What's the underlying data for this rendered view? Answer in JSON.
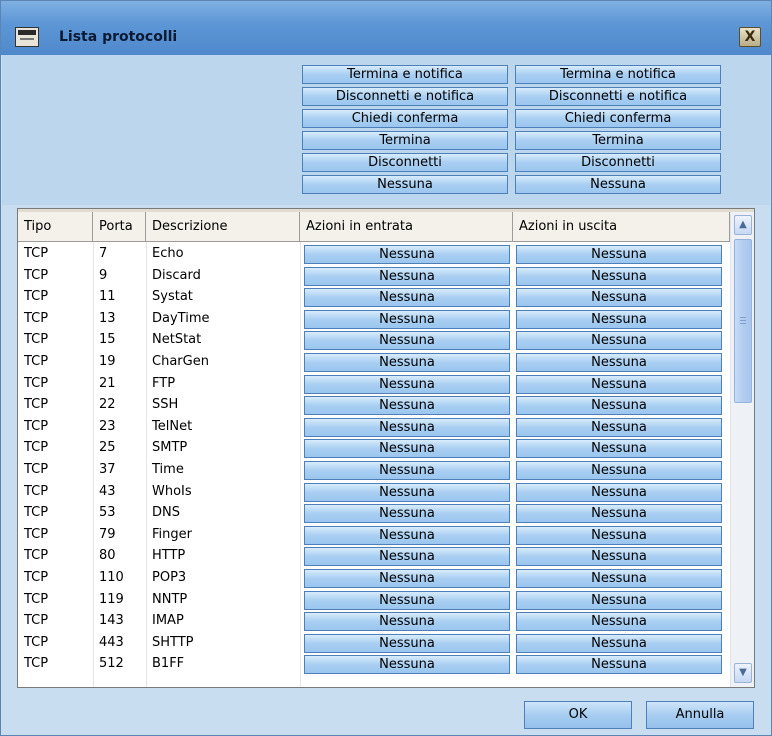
{
  "window": {
    "title": "Lista protocolli",
    "close_label": "X"
  },
  "actions": {
    "inbound": [
      "Termina e notifica",
      "Disconnetti e notifica",
      "Chiedi conferma",
      "Termina",
      "Disconnetti",
      "Nessuna"
    ],
    "outbound": [
      "Termina e notifica",
      "Disconnetti e notifica",
      "Chiedi conferma",
      "Termina",
      "Disconnetti",
      "Nessuna"
    ]
  },
  "table": {
    "columns": [
      "Tipo",
      "Porta",
      "Descrizione",
      "Azioni in entrata",
      "Azioni in uscita"
    ],
    "rows": [
      {
        "tipo": "TCP",
        "porta": "7",
        "descrizione": "Echo",
        "entrata": "Nessuna",
        "uscita": "Nessuna"
      },
      {
        "tipo": "TCP",
        "porta": "9",
        "descrizione": "Discard",
        "entrata": "Nessuna",
        "uscita": "Nessuna"
      },
      {
        "tipo": "TCP",
        "porta": "11",
        "descrizione": "Systat",
        "entrata": "Nessuna",
        "uscita": "Nessuna"
      },
      {
        "tipo": "TCP",
        "porta": "13",
        "descrizione": "DayTime",
        "entrata": "Nessuna",
        "uscita": "Nessuna"
      },
      {
        "tipo": "TCP",
        "porta": "15",
        "descrizione": "NetStat",
        "entrata": "Nessuna",
        "uscita": "Nessuna"
      },
      {
        "tipo": "TCP",
        "porta": "19",
        "descrizione": "CharGen",
        "entrata": "Nessuna",
        "uscita": "Nessuna"
      },
      {
        "tipo": "TCP",
        "porta": "21",
        "descrizione": "FTP",
        "entrata": "Nessuna",
        "uscita": "Nessuna"
      },
      {
        "tipo": "TCP",
        "porta": "22",
        "descrizione": "SSH",
        "entrata": "Nessuna",
        "uscita": "Nessuna"
      },
      {
        "tipo": "TCP",
        "porta": "23",
        "descrizione": "TelNet",
        "entrata": "Nessuna",
        "uscita": "Nessuna"
      },
      {
        "tipo": "TCP",
        "porta": "25",
        "descrizione": "SMTP",
        "entrata": "Nessuna",
        "uscita": "Nessuna"
      },
      {
        "tipo": "TCP",
        "porta": "37",
        "descrizione": "Time",
        "entrata": "Nessuna",
        "uscita": "Nessuna"
      },
      {
        "tipo": "TCP",
        "porta": "43",
        "descrizione": "WhoIs",
        "entrata": "Nessuna",
        "uscita": "Nessuna"
      },
      {
        "tipo": "TCP",
        "porta": "53",
        "descrizione": "DNS",
        "entrata": "Nessuna",
        "uscita": "Nessuna"
      },
      {
        "tipo": "TCP",
        "porta": "79",
        "descrizione": "Finger",
        "entrata": "Nessuna",
        "uscita": "Nessuna"
      },
      {
        "tipo": "TCP",
        "porta": "80",
        "descrizione": "HTTP",
        "entrata": "Nessuna",
        "uscita": "Nessuna"
      },
      {
        "tipo": "TCP",
        "porta": "110",
        "descrizione": "POP3",
        "entrata": "Nessuna",
        "uscita": "Nessuna"
      },
      {
        "tipo": "TCP",
        "porta": "119",
        "descrizione": "NNTP",
        "entrata": "Nessuna",
        "uscita": "Nessuna"
      },
      {
        "tipo": "TCP",
        "porta": "143",
        "descrizione": "IMAP",
        "entrata": "Nessuna",
        "uscita": "Nessuna"
      },
      {
        "tipo": "TCP",
        "porta": "443",
        "descrizione": "SHTTP",
        "entrata": "Nessuna",
        "uscita": "Nessuna"
      },
      {
        "tipo": "TCP",
        "porta": "512",
        "descrizione": "B1FF",
        "entrata": "Nessuna",
        "uscita": "Nessuna"
      }
    ]
  },
  "footer": {
    "ok_label": "OK",
    "cancel_label": "Annulla"
  },
  "icons": {
    "window": "window-icon",
    "close": "close-icon",
    "scroll_up": "chevron-up-icon",
    "scroll_down": "chevron-down-icon"
  },
  "colors": {
    "title_bar": "#5e97d6",
    "panel": "#c9ddf0",
    "button": "#a9cff2",
    "button_border": "#4d7fb8"
  }
}
